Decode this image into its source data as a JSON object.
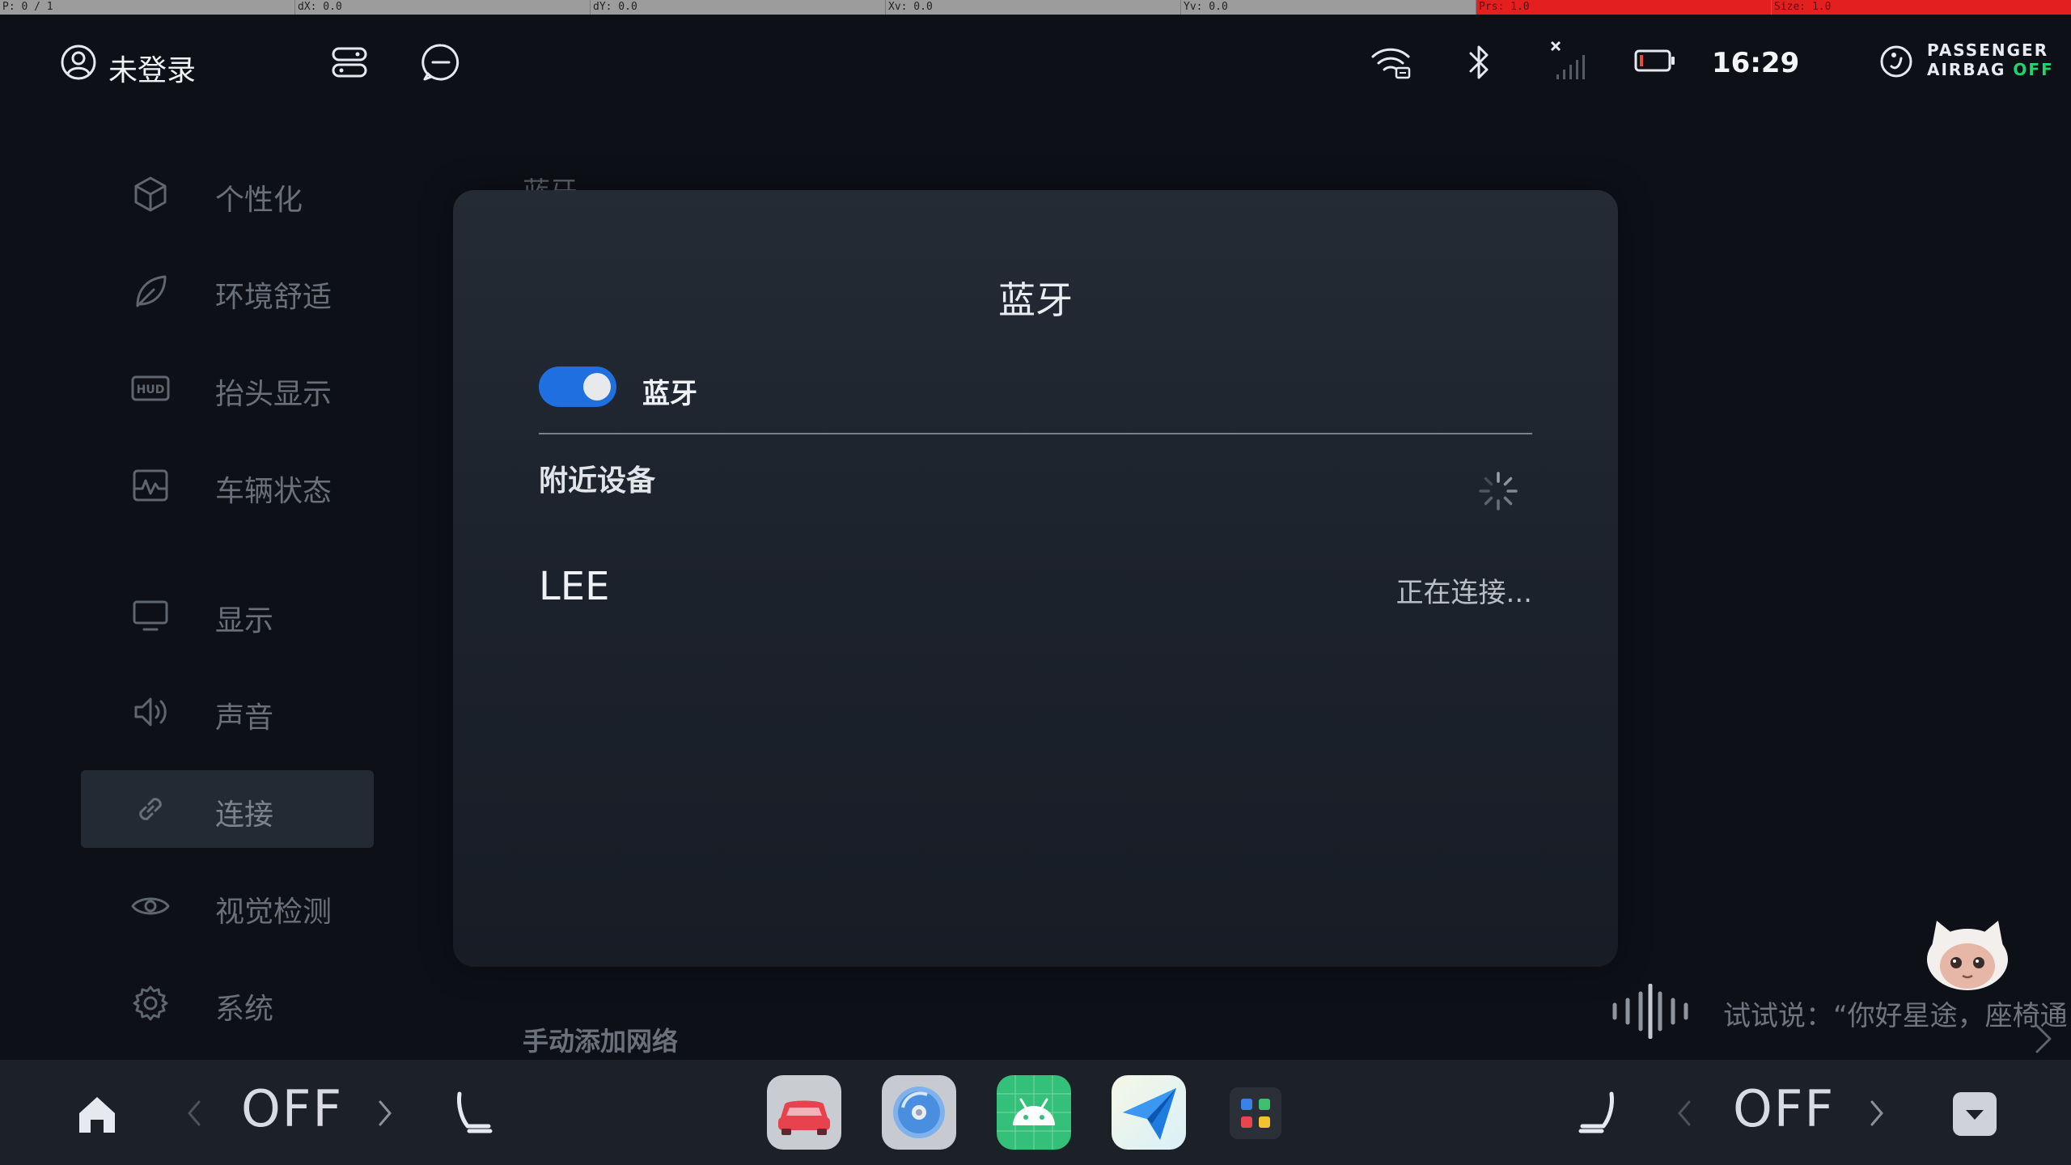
{
  "debug_bar": {
    "cells": [
      "P: 0 / 1",
      "dX: 0.0",
      "dY: 0.0",
      "Xv: 0.0",
      "Yv: 0.0",
      "Prs: 1.0",
      "Size: 1.0"
    ]
  },
  "status_bar": {
    "user_label": "未登录",
    "time": "16:29",
    "airbag_line1": "PASSENGER",
    "airbag_line2_prefix": "AIRBAG ",
    "airbag_state": "OFF"
  },
  "sidebar": {
    "items": [
      {
        "label": "个性化",
        "icon": "cube-icon"
      },
      {
        "label": "环境舒适",
        "icon": "leaf-icon"
      },
      {
        "label": "抬头显示",
        "icon": "hud-icon"
      },
      {
        "label": "车辆状态",
        "icon": "vehicle-status-icon"
      },
      {
        "label": "显示",
        "icon": "monitor-icon"
      },
      {
        "label": "声音",
        "icon": "speaker-icon"
      },
      {
        "label": "连接",
        "icon": "link-icon",
        "active": true
      },
      {
        "label": "视觉检测",
        "icon": "eye-icon"
      },
      {
        "label": "系统",
        "icon": "gear-icon"
      }
    ]
  },
  "background_page": {
    "peek_title": "蓝牙",
    "manual_add": "手动添加网络"
  },
  "dialog": {
    "title": "蓝牙",
    "toggle_label": "蓝牙",
    "toggle_on": true,
    "nearby_heading": "附近设备",
    "devices": [
      {
        "name": "LEE",
        "status": "正在连接..."
      }
    ]
  },
  "voice": {
    "hint": "试试说：“你好星途，座椅通"
  },
  "dock": {
    "left_value": "OFF",
    "right_value": "OFF",
    "apps": [
      "car-app-icon",
      "music-disc-app-icon",
      "android-app-icon",
      "navigation-app-icon",
      "app-grid-icon"
    ]
  },
  "colors": {
    "accent": "#1f6fe0",
    "airbag_off": "#22d36b",
    "background": "#0d1016",
    "dialog": "#1f252f"
  }
}
